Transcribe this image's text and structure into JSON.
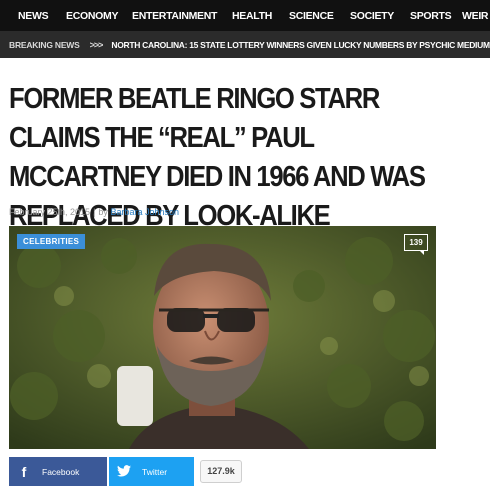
{
  "nav": {
    "items": [
      "NEWS",
      "ECONOMY",
      "ENTERTAINMENT",
      "HEALTH",
      "SCIENCE",
      "SOCIETY",
      "SPORTS",
      "WEIR"
    ]
  },
  "breaking": {
    "label": "BREAKING NEWS",
    "arrow": ">>>",
    "headline": "NORTH CAROLINA: 15 STATE LOTTERY WINNERS GIVEN LUCKY NUMBERS BY PSYCHIC MEDIUM"
  },
  "article": {
    "title": "FORMER BEATLE RINGO STARR CLAIMS THE “REAL” PAUL MCCARTNEY DIED IN 1966 AND WAS REPLACED BY LOOK-ALIKE",
    "date": "February 25th, 2015",
    "separator": "|",
    "by": "by",
    "author": "Barbara Johnson",
    "category": "CELEBRITIES",
    "comments": "139",
    "image_icon": "portrait-photo-icon"
  },
  "share": {
    "facebook_label": "Facebook",
    "facebook_icon": "facebook-icon",
    "twitter_label": "Twitter",
    "twitter_icon": "twitter-icon",
    "count": "127.9k"
  },
  "colors": {
    "nav_bg": "#111111",
    "breaking_bg": "#2b2b2b",
    "accent_blue": "#3b8fd9",
    "facebook": "#3b5998",
    "twitter": "#1da1f2",
    "author_link": "#2a7fc4"
  }
}
